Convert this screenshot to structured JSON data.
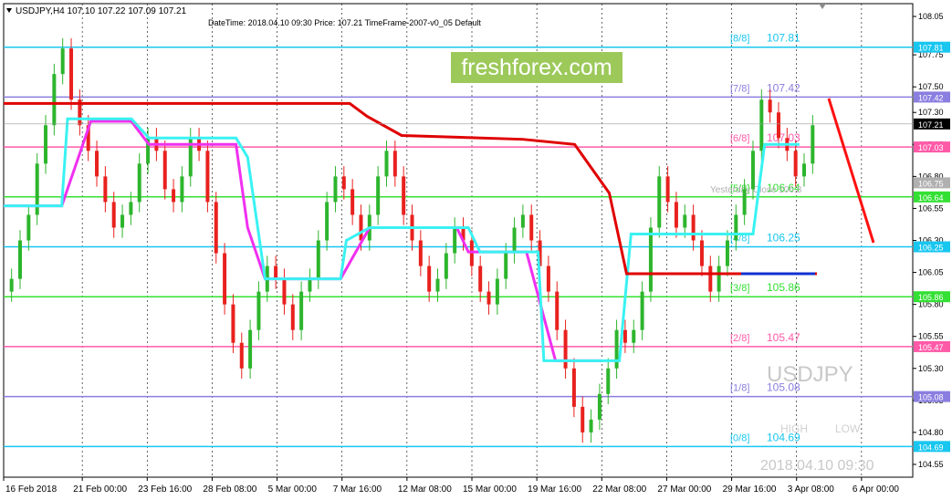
{
  "header": {
    "symbol_info": "USDJPY,H4  107.10 107.22 107.09 107.21",
    "indicator_info": "DateTime: 2018.04.10 09:30    Price: 107.21    TimeFrame-2007-v0_05    Default"
  },
  "watermark": {
    "brand": "freshforex.com",
    "symbol": "USDJPY",
    "high_label": "HIGH",
    "low_label": "LOW",
    "datetime": "2018.04.10 09:30",
    "yesterday_close": "Yesterday Close 106.8"
  },
  "colors": {
    "bull": "#2db52d",
    "bear": "#e8211e",
    "grid": "#000000",
    "level_blue": "#18c6f0",
    "level_purple": "#8a7ee0",
    "level_pink": "#ff5aa8",
    "level_green": "#33e033",
    "red_line": "#e00000",
    "cyan_line": "#3af2f2",
    "magenta_line": "#f030f0",
    "arrow": "#ff1010"
  },
  "chart_data": {
    "type": "candlestick",
    "symbol": "USDJPY",
    "timeframe": "H4",
    "ylim": [
      104.45,
      108.15
    ],
    "y_ticks": [
      "108.05",
      "107.75",
      "107.50",
      "107.30",
      "107.05",
      "106.80",
      "106.55",
      "106.30",
      "106.05",
      "105.80",
      "105.55",
      "105.30",
      "105.05",
      "104.80",
      "104.55"
    ],
    "x_ticks": [
      "16 Feb 2018",
      "21 Feb 00:00",
      "23 Feb 16:00",
      "28 Feb 08:00",
      "5 Mar 00:00",
      "7 Mar 16:00",
      "12 Mar 08:00",
      "15 Mar 00:00",
      "19 Mar 16:00",
      "22 Mar 08:00",
      "27 Mar 00:00",
      "29 Mar 16:00",
      "3 Apr 08:00",
      "6 Apr 00:00"
    ],
    "current_price": "107.21",
    "murrey_levels": [
      {
        "name": "[8/8]",
        "price": "107.81",
        "color": "level_blue"
      },
      {
        "name": "[7/8]",
        "price": "107.42",
        "color": "level_purple"
      },
      {
        "name": "[6/8]",
        "price": "107.03",
        "color": "level_pink"
      },
      {
        "name": "[5/8]",
        "price": "106.64",
        "color": "level_green"
      },
      {
        "name": "[4/8]",
        "price": "106.25",
        "color": "level_blue"
      },
      {
        "name": "[3/8]",
        "price": "105.86",
        "color": "level_green"
      },
      {
        "name": "[2/8]",
        "price": "105.47",
        "color": "level_pink"
      },
      {
        "name": "[1/8]",
        "price": "105.08",
        "color": "level_purple"
      },
      {
        "name": "[0/8]",
        "price": "104.69",
        "color": "level_blue"
      }
    ],
    "price_labels_right": [
      "107.81",
      "107.42",
      "107.21",
      "107.03",
      "106.75",
      "106.64",
      "106.25",
      "105.86",
      "105.47",
      "105.08",
      "104.69"
    ],
    "close_series": [
      106.0,
      106.3,
      106.5,
      106.9,
      107.2,
      107.6,
      107.8,
      107.4,
      107.2,
      107.0,
      106.8,
      106.6,
      106.4,
      106.5,
      106.6,
      106.9,
      107.1,
      107.0,
      106.7,
      106.6,
      106.8,
      107.1,
      107.0,
      106.6,
      106.2,
      105.8,
      105.5,
      105.3,
      105.6,
      105.9,
      106.1,
      106.0,
      105.8,
      105.6,
      105.9,
      106.0,
      106.3,
      106.6,
      106.8,
      106.7,
      106.5,
      106.3,
      106.5,
      106.8,
      107.0,
      106.8,
      106.5,
      106.3,
      106.1,
      105.9,
      106.0,
      106.2,
      106.4,
      106.3,
      106.1,
      105.9,
      105.8,
      106.0,
      106.2,
      106.4,
      106.5,
      106.3,
      106.1,
      105.9,
      105.6,
      105.3,
      105.0,
      104.8,
      104.9,
      105.1,
      105.3,
      105.6,
      105.5,
      105.6,
      105.9,
      106.4,
      106.8,
      106.6,
      106.4,
      106.5,
      106.3,
      106.1,
      105.9,
      106.1,
      106.3,
      106.5,
      106.7,
      107.0,
      107.4,
      107.3,
      107.1,
      107.0,
      106.8,
      106.9,
      107.2
    ],
    "red_trail": [
      [
        0,
        107.37
      ],
      [
        40,
        107.37
      ],
      [
        42,
        107.27
      ],
      [
        46,
        107.12
      ],
      [
        60,
        107.09
      ],
      [
        66,
        107.05
      ],
      [
        70,
        106.67
      ],
      [
        72,
        106.04
      ],
      [
        94,
        106.04
      ]
    ],
    "cyan_trail": [
      [
        0,
        106.57
      ],
      [
        10,
        106.57
      ],
      [
        11,
        107.25
      ],
      [
        22,
        107.25
      ],
      [
        25,
        107.1
      ],
      [
        40,
        107.1
      ],
      [
        42,
        106.95
      ],
      [
        45,
        106.0
      ],
      [
        58,
        106.0
      ],
      [
        59,
        106.3
      ],
      [
        63,
        106.4
      ],
      [
        80,
        106.4
      ],
      [
        82,
        106.21
      ],
      [
        92,
        106.21
      ],
      [
        93,
        105.36
      ],
      [
        106,
        105.36
      ],
      [
        108,
        106.35
      ],
      [
        129,
        106.35
      ],
      [
        131,
        107.05
      ],
      [
        137,
        107.05
      ]
    ],
    "magenta_trail": [
      [
        0,
        106.57
      ],
      [
        10,
        106.57
      ],
      [
        15,
        107.23
      ],
      [
        22,
        107.23
      ],
      [
        25,
        107.05
      ],
      [
        40,
        107.05
      ],
      [
        42,
        106.4
      ],
      [
        45,
        106.0
      ],
      [
        58,
        106.0
      ],
      [
        63,
        106.4
      ],
      [
        78,
        106.4
      ],
      [
        80,
        106.21
      ],
      [
        90,
        106.21
      ],
      [
        95,
        105.36
      ],
      [
        103,
        105.36
      ]
    ]
  }
}
